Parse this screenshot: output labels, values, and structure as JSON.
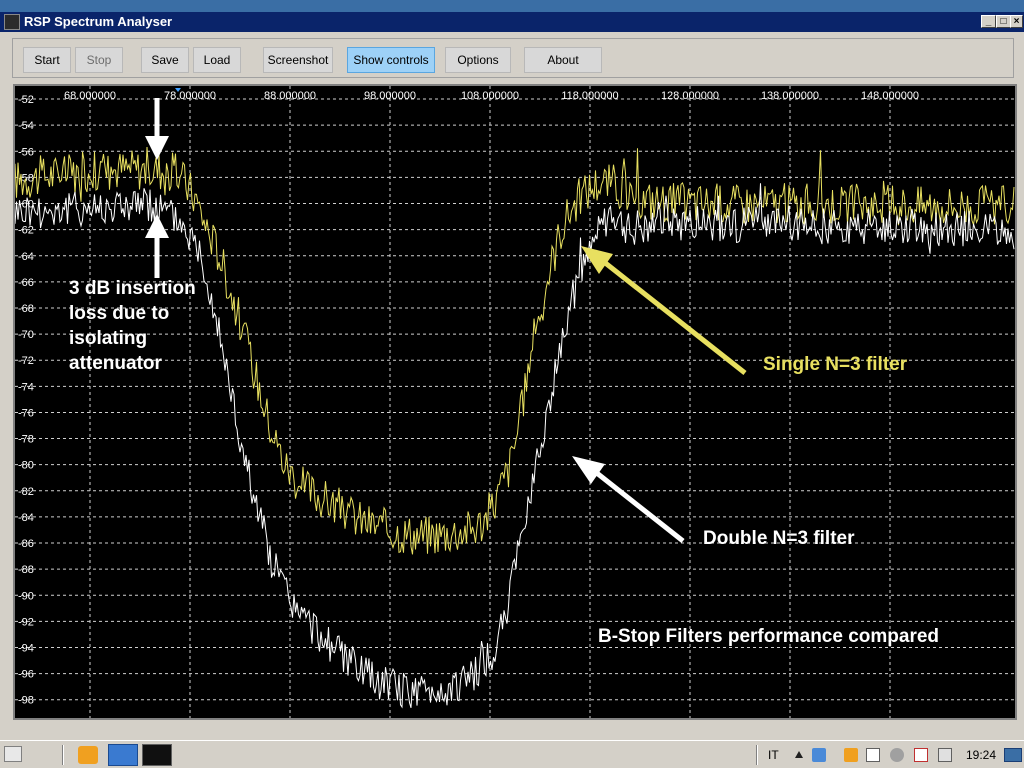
{
  "window": {
    "title": "RSP Spectrum Analyser"
  },
  "toolbar": {
    "buttons": [
      {
        "label": "Start",
        "state": "normal"
      },
      {
        "label": "Stop",
        "state": "disabled"
      },
      {
        "label": "Save",
        "state": "normal"
      },
      {
        "label": "Load",
        "state": "normal"
      },
      {
        "label": "Screenshot",
        "state": "normal"
      },
      {
        "label": "Show controls",
        "state": "active"
      },
      {
        "label": "Options",
        "state": "normal"
      },
      {
        "label": "About",
        "state": "normal"
      }
    ]
  },
  "chart_data": {
    "type": "line",
    "xlim": [
      60.5,
      160.5
    ],
    "ylim": [
      -99.4,
      -51.0
    ],
    "x_ticks": [
      68,
      78,
      88,
      98,
      108,
      118,
      128,
      138,
      148
    ],
    "x_tick_labels": [
      "68.000000",
      "78.000000",
      "88.000000",
      "98.000000",
      "108.000000",
      "118.000000",
      "128.000000",
      "138.000000",
      "148.000000"
    ],
    "y_ticks": [
      -52,
      -54,
      -56,
      -58,
      -60,
      -62,
      -64,
      -66,
      -68,
      -70,
      -72,
      -74,
      -76,
      -78,
      -80,
      -82,
      -84,
      -86,
      -88,
      -90,
      -92,
      -94,
      -96,
      -98
    ],
    "y_tick_labels": [
      "-52",
      "-54",
      "-56",
      "-58",
      "-60",
      "-62",
      "-64",
      "-66",
      "-68",
      "-70",
      "-72",
      "-74",
      "-76",
      "-78",
      "-80",
      "-82",
      "-84",
      "-86",
      "-88",
      "-90",
      "-92",
      "-94",
      "-96",
      "-98"
    ],
    "grid": true,
    "series": [
      {
        "name": "Single N=3 filter",
        "color": "#e8e060",
        "points": [
          [
            60.5,
            -58.2
          ],
          [
            64,
            -57.8
          ],
          [
            68,
            -57.5
          ],
          [
            72,
            -57.3
          ],
          [
            75,
            -57.4
          ],
          [
            77,
            -57.8
          ],
          [
            78.5,
            -59.5
          ],
          [
            79.5,
            -61.5
          ],
          [
            81,
            -64
          ],
          [
            82,
            -66.5
          ],
          [
            83,
            -69
          ],
          [
            84.5,
            -73
          ],
          [
            86,
            -77
          ],
          [
            87.5,
            -80
          ],
          [
            89,
            -81.5
          ],
          [
            91,
            -82.5
          ],
          [
            93,
            -83.3
          ],
          [
            95,
            -84.2
          ],
          [
            97,
            -84.8
          ],
          [
            99,
            -85.2
          ],
          [
            101,
            -85.4
          ],
          [
            103,
            -85.3
          ],
          [
            105,
            -85.1
          ],
          [
            106.5,
            -84.8
          ],
          [
            107.5,
            -84.2
          ],
          [
            108.5,
            -82.8
          ],
          [
            110,
            -80
          ],
          [
            111,
            -76.5
          ],
          [
            112,
            -72
          ],
          [
            113,
            -68
          ],
          [
            114,
            -65
          ],
          [
            115,
            -62.2
          ],
          [
            116,
            -60.5
          ],
          [
            117,
            -59.5
          ],
          [
            118,
            -58.8
          ],
          [
            119,
            -58.3
          ],
          [
            120.5,
            -58.5
          ],
          [
            122,
            -59.6
          ],
          [
            126,
            -59.9
          ],
          [
            132,
            -60.0
          ],
          [
            140,
            -60.0
          ],
          [
            150,
            -60.1
          ],
          [
            160.5,
            -60.2
          ]
        ]
      },
      {
        "name": "Double N=3 filter",
        "color": "#ffffff",
        "points": [
          [
            60.5,
            -60.5
          ],
          [
            64,
            -60.5
          ],
          [
            68,
            -60.3
          ],
          [
            72,
            -60.0
          ],
          [
            75,
            -60.3
          ],
          [
            77,
            -61.3
          ],
          [
            79,
            -63.5
          ],
          [
            80,
            -66.5
          ],
          [
            81,
            -70
          ],
          [
            82,
            -74
          ],
          [
            83,
            -78
          ],
          [
            84,
            -81
          ],
          [
            85,
            -84
          ],
          [
            86,
            -87
          ],
          [
            87.5,
            -89.5
          ],
          [
            89,
            -91.5
          ],
          [
            91,
            -93
          ],
          [
            93,
            -94.5
          ],
          [
            95,
            -95.8
          ],
          [
            97,
            -96.6
          ],
          [
            99,
            -97.2
          ],
          [
            101,
            -97.4
          ],
          [
            103,
            -97.3
          ],
          [
            105,
            -96.8
          ],
          [
            106.5,
            -96
          ],
          [
            108,
            -95
          ],
          [
            109,
            -93
          ],
          [
            110,
            -90
          ],
          [
            111,
            -86
          ],
          [
            112,
            -82
          ],
          [
            113,
            -78.5
          ],
          [
            114,
            -75
          ],
          [
            115,
            -71.5
          ],
          [
            116,
            -68
          ],
          [
            117,
            -65
          ],
          [
            118,
            -63
          ],
          [
            119,
            -62
          ],
          [
            120,
            -61.5
          ],
          [
            122,
            -61.8
          ],
          [
            126,
            -61.5
          ],
          [
            132,
            -61.6
          ],
          [
            140,
            -61.7
          ],
          [
            150,
            -61.8
          ],
          [
            160.5,
            -62.0
          ]
        ]
      }
    ]
  },
  "annotations": {
    "insertion_loss_lines": [
      "3 dB insertion",
      "loss due to",
      "isolating",
      "attenuator"
    ],
    "single_filter": "Single N=3 filter",
    "double_filter": "Double N=3 filter",
    "comparison_title": "B-Stop Filters performance compared"
  },
  "taskbar": {
    "language": "IT",
    "clock": "19:24"
  },
  "colors": {
    "plot_background": "#000000",
    "grid": "#d0d0d0",
    "single_trace": "#e8e060",
    "double_trace": "#ffffff",
    "active_button": "#9dd1f7",
    "title_bar": "#0a246a"
  }
}
